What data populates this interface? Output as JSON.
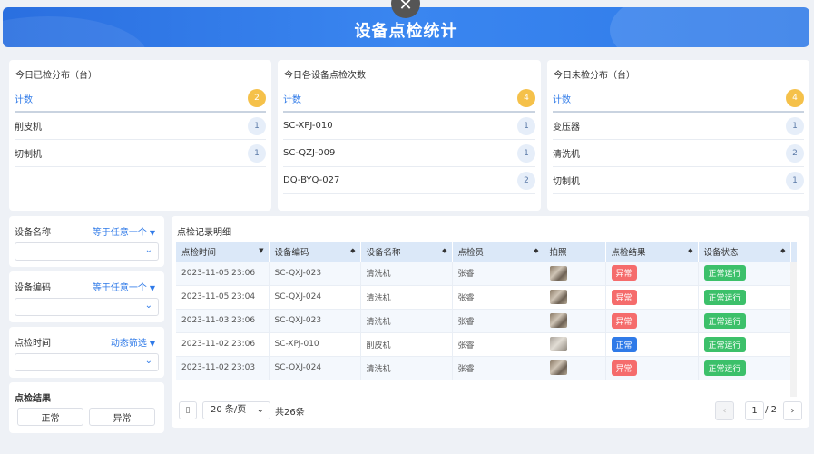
{
  "header": {
    "title": "设备点检统计"
  },
  "stats": [
    {
      "title": "今日已检分布（台）",
      "head": {
        "label": "计数",
        "value": "2"
      },
      "rows": [
        {
          "label": "削皮机",
          "value": "1"
        },
        {
          "label": "切制机",
          "value": "1"
        }
      ]
    },
    {
      "title": "今日各设备点检次数",
      "head": {
        "label": "计数",
        "value": "4"
      },
      "rows": [
        {
          "label": "SC-XPJ-010",
          "value": "1"
        },
        {
          "label": "SC-QZJ-009",
          "value": "1"
        },
        {
          "label": "DQ-BYQ-027",
          "value": "2"
        }
      ]
    },
    {
      "title": "今日未检分布（台）",
      "head": {
        "label": "计数",
        "value": "4"
      },
      "rows": [
        {
          "label": "变压器",
          "value": "1"
        },
        {
          "label": "清洗机",
          "value": "2"
        },
        {
          "label": "切制机",
          "value": "1"
        }
      ]
    }
  ],
  "filters": {
    "device_name": {
      "label": "设备名称",
      "mode": "等于任意一个"
    },
    "device_code": {
      "label": "设备编码",
      "mode": "等于任意一个"
    },
    "check_time": {
      "label": "点检时间",
      "mode": "动态筛选"
    },
    "result": {
      "label": "点检结果",
      "options": [
        "正常",
        "异常"
      ]
    }
  },
  "detail": {
    "title": "点检记录明细",
    "columns": [
      "点检时间",
      "设备编码",
      "设备名称",
      "点检员",
      "拍照",
      "点检结果",
      "设备状态"
    ],
    "rows": [
      {
        "time": "2023-11-05 23:06",
        "code": "SC-QXJ-023",
        "name": "清洗机",
        "inspector": "张睿",
        "result": "异常",
        "status": "正常运行"
      },
      {
        "time": "2023-11-05 23:04",
        "code": "SC-QXJ-024",
        "name": "清洗机",
        "inspector": "张睿",
        "result": "异常",
        "status": "正常运行"
      },
      {
        "time": "2023-11-03 23:06",
        "code": "SC-QXJ-023",
        "name": "清洗机",
        "inspector": "张睿",
        "result": "异常",
        "status": "正常运行"
      },
      {
        "time": "2023-11-02 23:06",
        "code": "SC-XPJ-010",
        "name": "削皮机",
        "inspector": "张睿",
        "result": "正常",
        "status": "正常运行"
      },
      {
        "time": "2023-11-02 23:03",
        "code": "SC-QXJ-024",
        "name": "清洗机",
        "inspector": "张睿",
        "result": "异常",
        "status": "正常运行"
      }
    ]
  },
  "pager": {
    "page_size": "20 条/页",
    "total": "共26条",
    "current": "1",
    "of": "/ 2"
  }
}
